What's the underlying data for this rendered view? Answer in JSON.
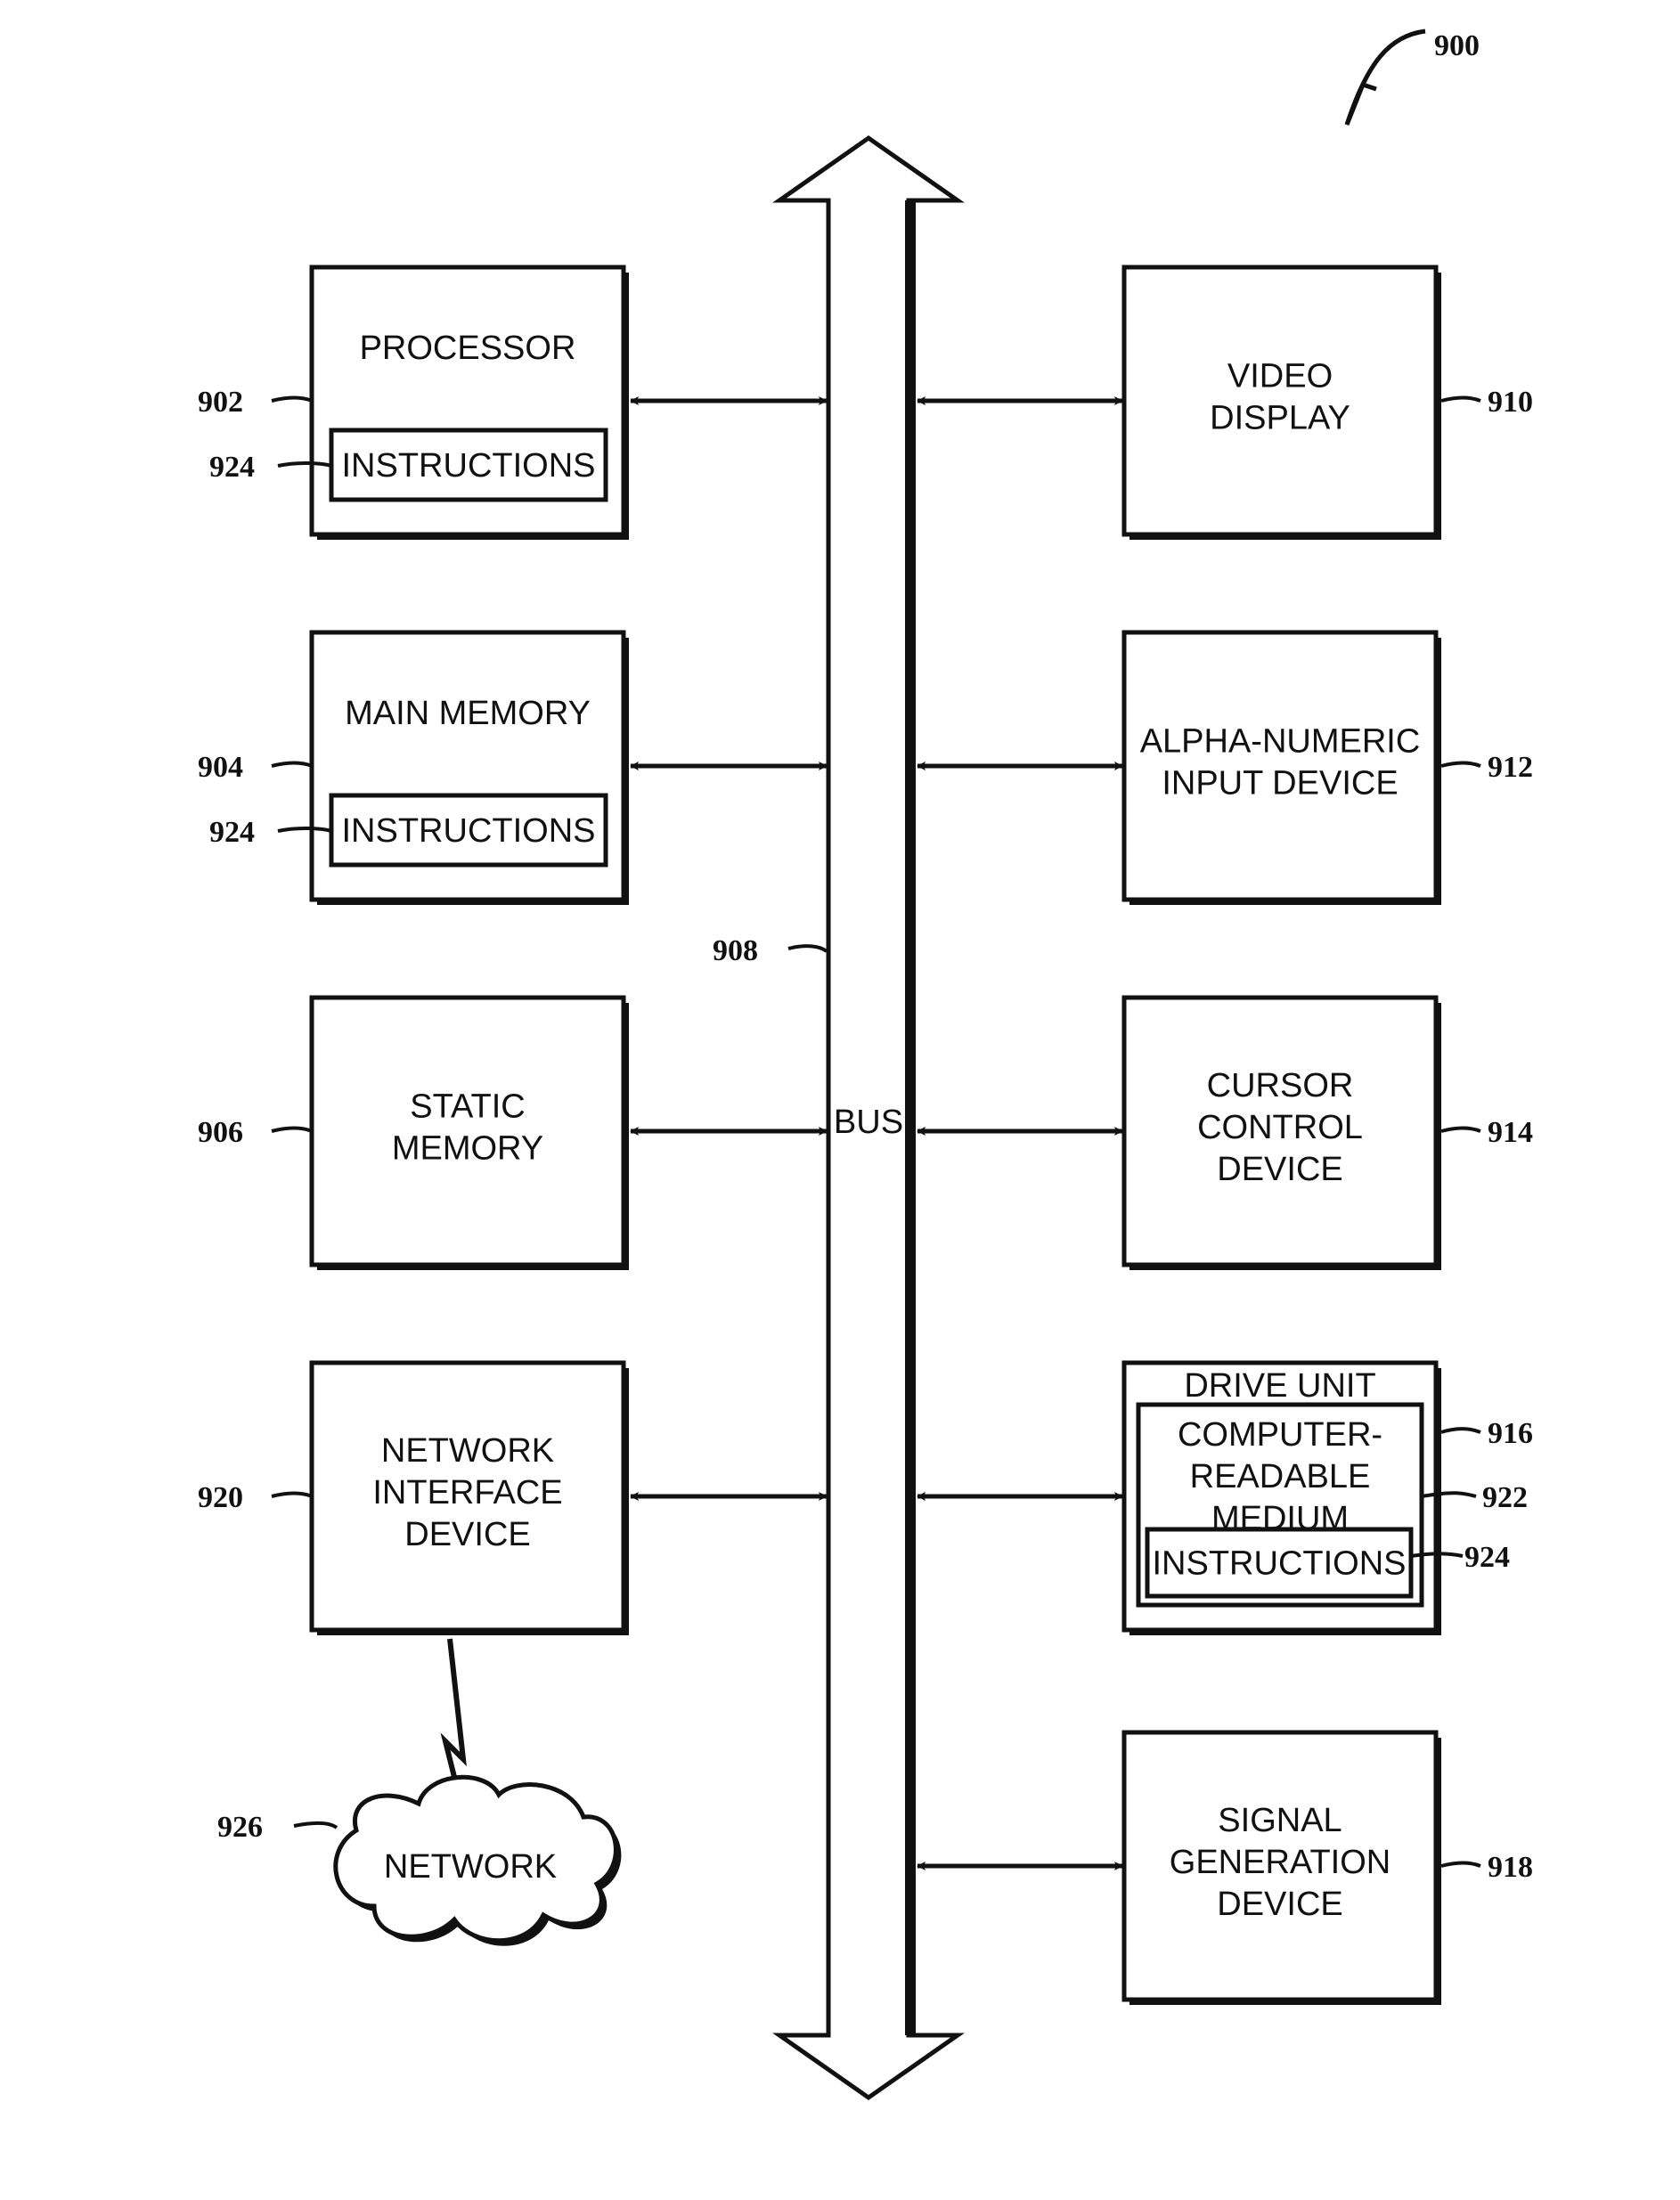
{
  "figure_ref": "900",
  "bus": {
    "label": "BUS",
    "ref": "908"
  },
  "left_blocks": [
    {
      "id": "processor",
      "label_lines": [
        "PROCESSOR"
      ],
      "ref": "902",
      "inner": {
        "label": "INSTRUCTIONS",
        "ref": "924"
      }
    },
    {
      "id": "main-memory",
      "label_lines": [
        "MAIN MEMORY"
      ],
      "ref": "904",
      "inner": {
        "label": "INSTRUCTIONS",
        "ref": "924"
      }
    },
    {
      "id": "static-memory",
      "label_lines": [
        "STATIC",
        "MEMORY"
      ],
      "ref": "906"
    },
    {
      "id": "network-interface-device",
      "label_lines": [
        "NETWORK",
        "INTERFACE",
        "DEVICE"
      ],
      "ref": "920"
    }
  ],
  "right_blocks": [
    {
      "id": "video-display",
      "label_lines": [
        "VIDEO",
        "DISPLAY"
      ],
      "ref": "910"
    },
    {
      "id": "alpha-numeric-input-device",
      "label_lines": [
        "ALPHA-NUMERIC",
        "INPUT DEVICE"
      ],
      "ref": "912"
    },
    {
      "id": "cursor-control-device",
      "label_lines": [
        "CURSOR",
        "CONTROL",
        "DEVICE"
      ],
      "ref": "914"
    },
    {
      "id": "drive-unit",
      "label_lines": [
        "DRIVE UNIT"
      ],
      "ref": "916",
      "medium": {
        "label_lines": [
          "COMPUTER-",
          "READABLE",
          "MEDIUM"
        ],
        "ref": "922"
      },
      "inner": {
        "label": "INSTRUCTIONS",
        "ref": "924"
      }
    },
    {
      "id": "signal-generation-device",
      "label_lines": [
        "SIGNAL",
        "GENERATION",
        "DEVICE"
      ],
      "ref": "918"
    }
  ],
  "network": {
    "label": "NETWORK",
    "ref": "926"
  }
}
